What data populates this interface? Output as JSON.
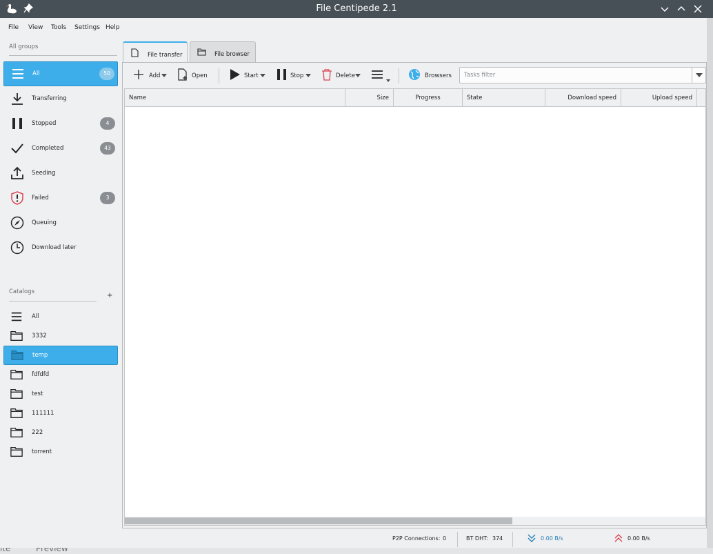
{
  "window": {
    "title": "File Centipede 2.1"
  },
  "menu": [
    "File",
    "View",
    "Tools",
    "Settings",
    "Help"
  ],
  "groups": {
    "header": "All groups",
    "items": [
      {
        "label": "All",
        "badge": "50",
        "icon": "list-icon"
      },
      {
        "label": "Transferring",
        "badge": "",
        "icon": "download-icon"
      },
      {
        "label": "Stopped",
        "badge": "4",
        "icon": "pause-icon"
      },
      {
        "label": "Completed",
        "badge": "43",
        "icon": "checkmark-icon"
      },
      {
        "label": "Seeding",
        "badge": "",
        "icon": "upload-icon"
      },
      {
        "label": "Failed",
        "badge": "3",
        "icon": "shield-warning-icon"
      },
      {
        "label": "Queuing",
        "badge": "",
        "icon": "compass-icon"
      },
      {
        "label": "Download later",
        "badge": "",
        "icon": "clock-icon"
      }
    ],
    "selected": "All"
  },
  "catalogs": {
    "header": "Catalogs",
    "add_label": "+",
    "items": [
      "All",
      "3332",
      "temp",
      "fdfdfd",
      "test",
      "111111",
      "222",
      "torrent"
    ],
    "selected": "temp"
  },
  "tabs": [
    {
      "label": "File transfer",
      "active": true
    },
    {
      "label": "File browser",
      "active": false
    }
  ],
  "toolbar": {
    "add": "Add",
    "open": "Open",
    "start": "Start",
    "stop": "Stop",
    "delete": "Delete",
    "browsers": "Browsers",
    "filter_placeholder": "Tasks filter"
  },
  "table": {
    "columns": [
      "Name",
      "Size",
      "Progress",
      "State",
      "Download speed",
      "Upload speed"
    ],
    "rows": []
  },
  "status": {
    "p2p_label": "P2P Connections:",
    "p2p_value": "0",
    "dht_label": "BT DHT:",
    "dht_value": "374",
    "download_speed": "0.00 B/s",
    "upload_speed": "0.00 B/s"
  },
  "colors": {
    "accent": "#3daee9",
    "titlebar": "#475057",
    "delete_red": "#da4453",
    "download_blue": "#2980b9",
    "upload_red": "#da4453"
  },
  "background_strip": {
    "left_text": "ite",
    "preview_text": "Preview"
  }
}
